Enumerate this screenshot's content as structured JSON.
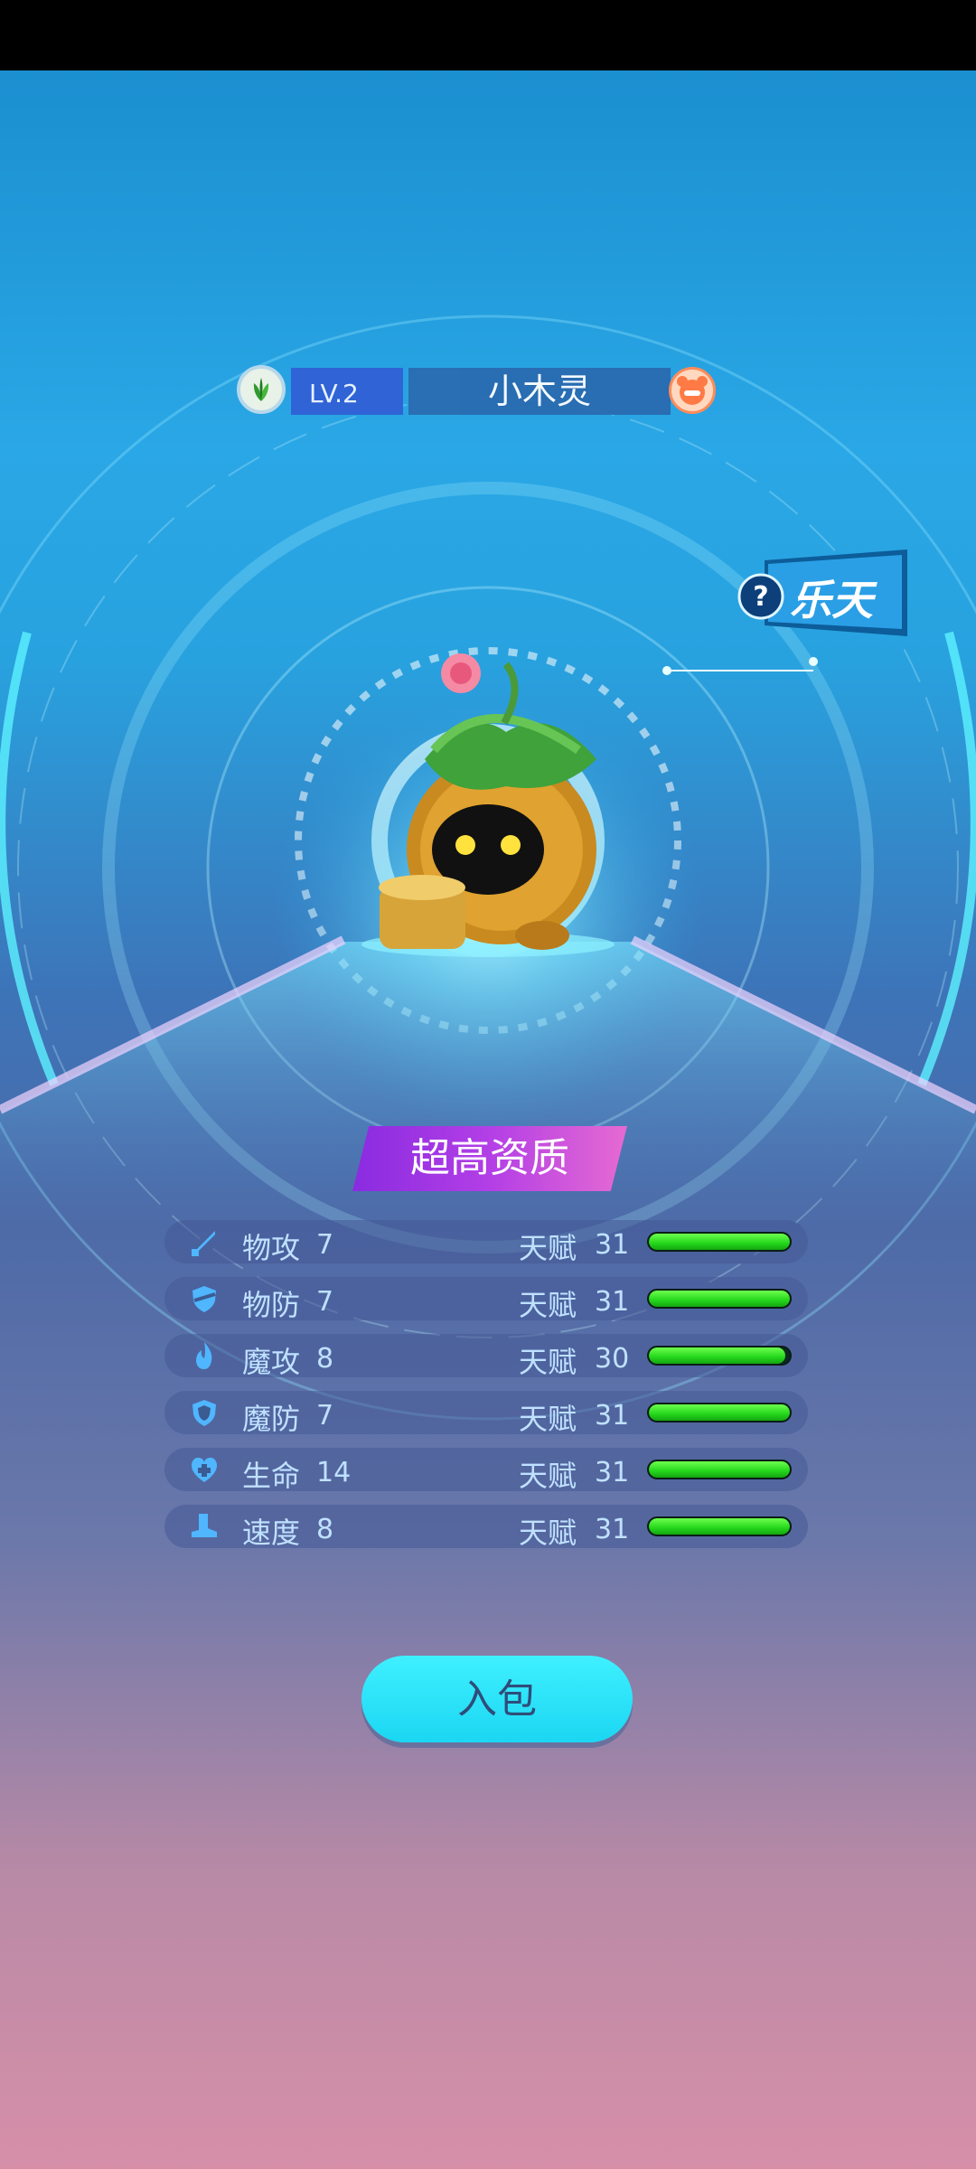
{
  "pet": {
    "level": "LV.2",
    "name": "小木灵",
    "element_icon": "leaf-element-icon",
    "faction_icon": "bear-faction-icon"
  },
  "tag": {
    "icon": "question-icon",
    "text": "乐天"
  },
  "quality": "超高资质",
  "talent_label": "天赋",
  "stats": [
    {
      "icon": "sword-icon",
      "label": "物攻",
      "value": "7",
      "talent": "31",
      "talent_fraction": 1.0
    },
    {
      "icon": "shield-slash-icon",
      "label": "物防",
      "value": "7",
      "talent": "31",
      "talent_fraction": 1.0
    },
    {
      "icon": "flame-icon",
      "label": "魔攻",
      "value": "8",
      "talent": "30",
      "talent_fraction": 0.97
    },
    {
      "icon": "shield-icon",
      "label": "魔防",
      "value": "7",
      "talent": "31",
      "talent_fraction": 1.0
    },
    {
      "icon": "heart-plus-icon",
      "label": "生命",
      "value": "14",
      "talent": "31",
      "talent_fraction": 1.0
    },
    {
      "icon": "boot-icon",
      "label": "速度",
      "value": "8",
      "talent": "31",
      "talent_fraction": 1.0
    }
  ],
  "button": {
    "label": "入包"
  },
  "colors": {
    "bar_fill": "#23d61b",
    "button": "#1bd6f2",
    "quality_banner": "#b33fe6"
  }
}
